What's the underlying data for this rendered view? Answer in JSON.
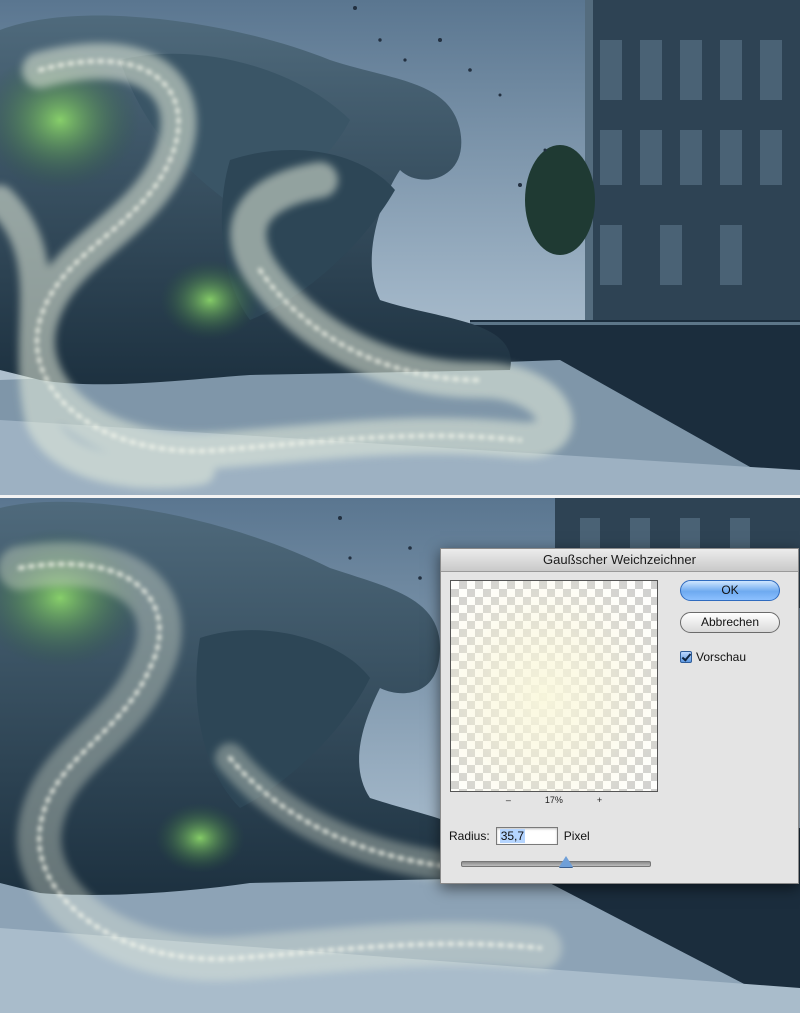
{
  "dialog": {
    "title": "Gaußscher Weichzeichner",
    "ok_label": "OK",
    "cancel_label": "Abbrechen",
    "preview_label": "Vorschau",
    "preview_checked": true,
    "zoom_out": "–",
    "zoom_level": "17%",
    "zoom_in": "+",
    "radius_label": "Radius:",
    "radius_value": "35,7",
    "radius_unit": "Pixel",
    "slider_level": 0.55
  },
  "colors": {
    "ok_button": "#6eaaf0",
    "checkbox": "#5e98e0",
    "sky": "#8ea7bc",
    "glow": "#f4f6dc"
  },
  "icons": [
    "checkmark-icon",
    "slider-thumb-icon"
  ]
}
